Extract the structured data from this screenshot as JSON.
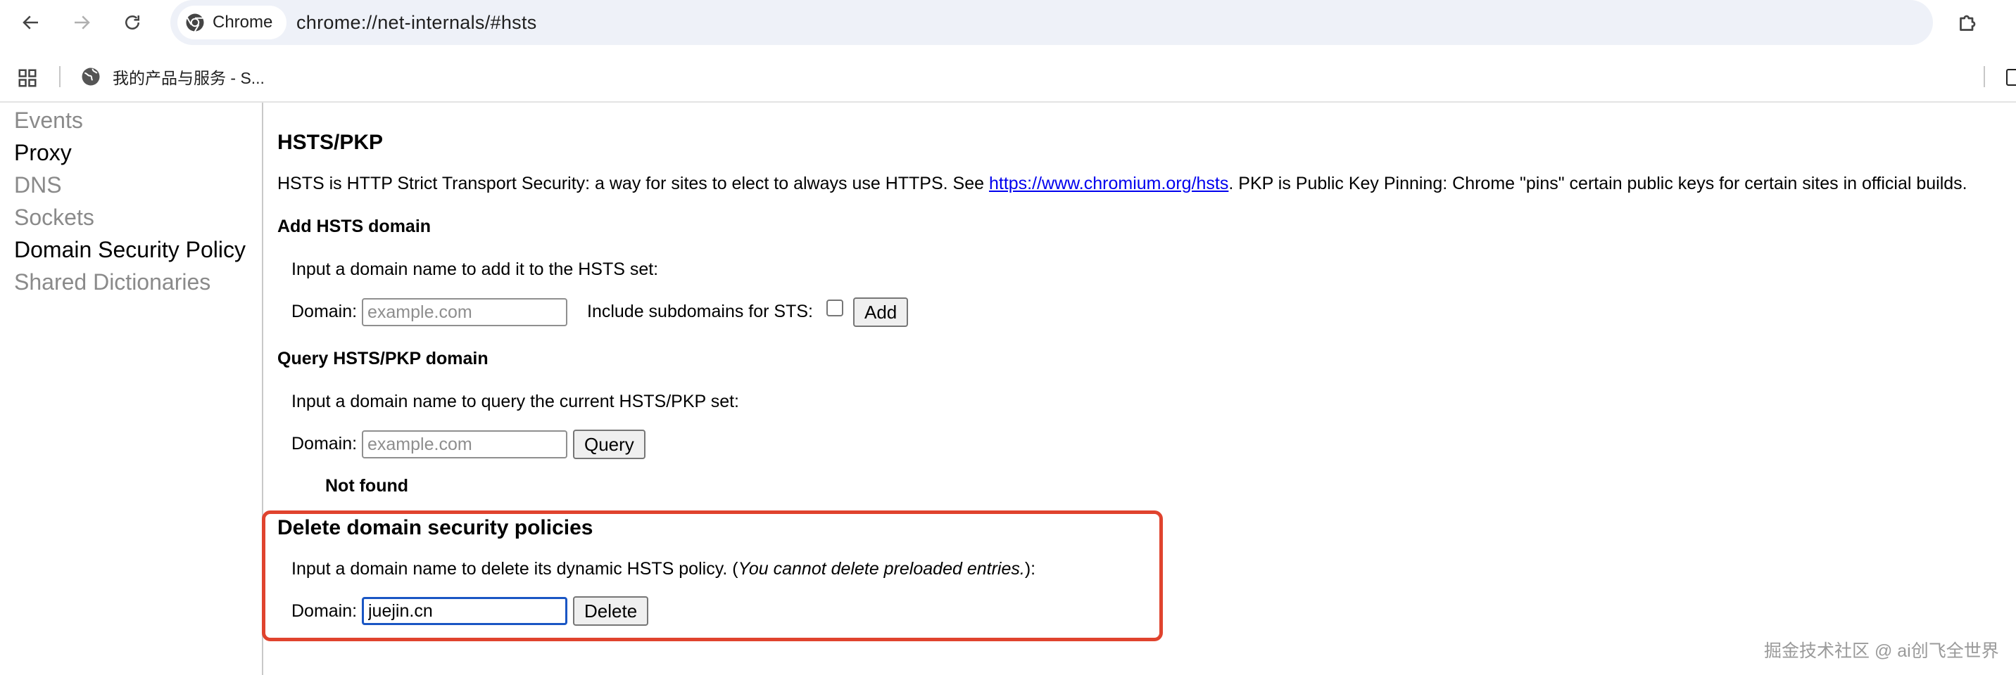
{
  "browser": {
    "chip_label": "Chrome",
    "url": "chrome://net-internals/#hsts",
    "bookmark_label": "我的产品与服务 - S..."
  },
  "sidebar": {
    "items": [
      {
        "label": "Events",
        "state": "disabled"
      },
      {
        "label": "Proxy",
        "state": "enabled"
      },
      {
        "label": "DNS",
        "state": "disabled"
      },
      {
        "label": "Sockets",
        "state": "disabled"
      },
      {
        "label": "Domain Security Policy",
        "state": "enabled"
      },
      {
        "label": "Shared Dictionaries",
        "state": "disabled"
      }
    ]
  },
  "main": {
    "title": "HSTS/PKP",
    "intro": {
      "before": "HSTS is HTTP Strict Transport Security: a way for sites to elect to always use HTTPS. See ",
      "link": "https://www.chromium.org/hsts",
      "after": ". PKP is Public Key Pinning: Chrome \"pins\" certain public keys for certain sites in official builds."
    },
    "add": {
      "heading": "Add HSTS domain",
      "instruction": "Input a domain name to add it to the HSTS set:",
      "domain_label": "Domain:",
      "placeholder": "example.com",
      "sts_label": "Include subdomains for STS:",
      "button": "Add"
    },
    "query": {
      "heading": "Query HSTS/PKP domain",
      "instruction": "Input a domain name to query the current HSTS/PKP set:",
      "domain_label": "Domain:",
      "placeholder": "example.com",
      "button": "Query",
      "result": "Not found"
    },
    "delete": {
      "heading": "Delete domain security policies",
      "instruction_before": "Input a domain name to delete its dynamic HSTS policy. (",
      "instruction_italic": "You cannot delete preloaded entries.",
      "instruction_after": "):",
      "domain_label": "Domain:",
      "value": "juejin.cn",
      "button": "Delete"
    }
  },
  "watermark": "掘金技术社区 @ ai创飞全世界",
  "colors": {
    "highlight": "#e0432e",
    "link": "#0000ee",
    "focus": "#1a56c4"
  }
}
